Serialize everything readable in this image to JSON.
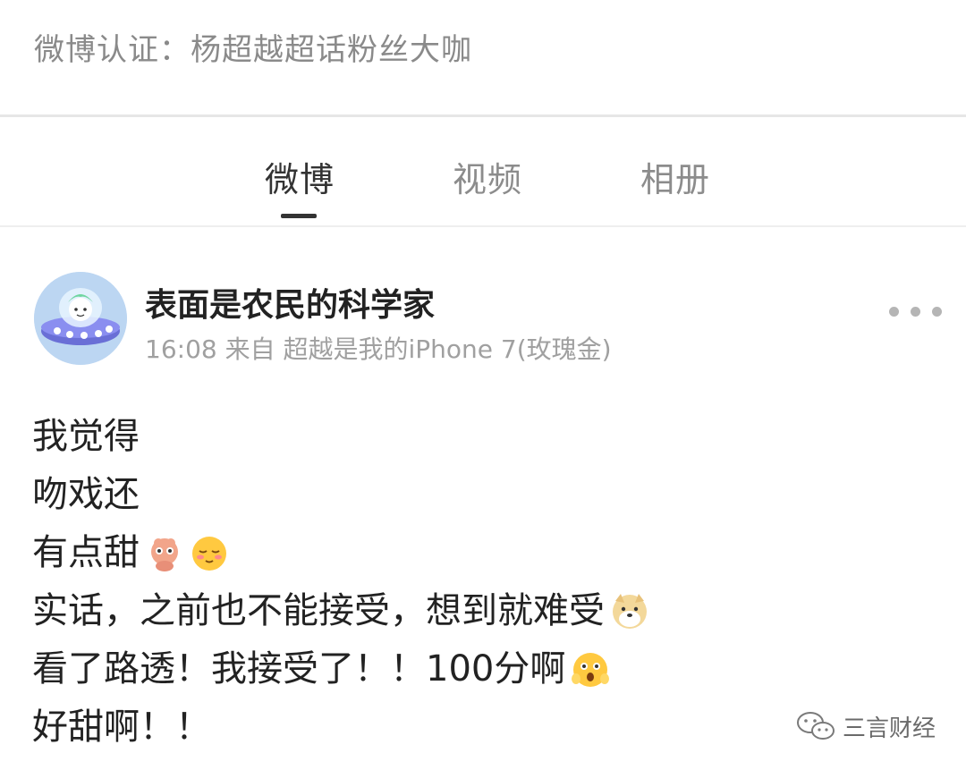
{
  "profile": {
    "verification": "微博认证：杨超越超话粉丝大咖"
  },
  "tabs": [
    {
      "label": "微博",
      "active": true
    },
    {
      "label": "视频",
      "active": false
    },
    {
      "label": "相册",
      "active": false
    }
  ],
  "post": {
    "username": "表面是农民的科学家",
    "meta": "16:08 来自 超越是我的iPhone 7(玫瑰金)",
    "lines": [
      {
        "text": "我觉得",
        "emojis": []
      },
      {
        "text": "吻戏还",
        "emojis": []
      },
      {
        "text": "有点甜",
        "emojis": [
          "shy-emoji",
          "blush-emoji"
        ]
      },
      {
        "text": "实话，之前也不能接受，想到就难受",
        "emojis": [
          "doge-emoji"
        ]
      },
      {
        "text": "看了路透！我接受了！！100分啊",
        "emojis": [
          "surprised-emoji"
        ]
      },
      {
        "text": "好甜啊！！",
        "emojis": []
      }
    ]
  },
  "watermark": {
    "text": "三言财经",
    "icon": "wechat-icon"
  },
  "colors": {
    "text_primary": "#222222",
    "text_secondary": "#a0a0a0",
    "tab_active": "#333333",
    "tab_inactive": "#8c8c8c"
  }
}
